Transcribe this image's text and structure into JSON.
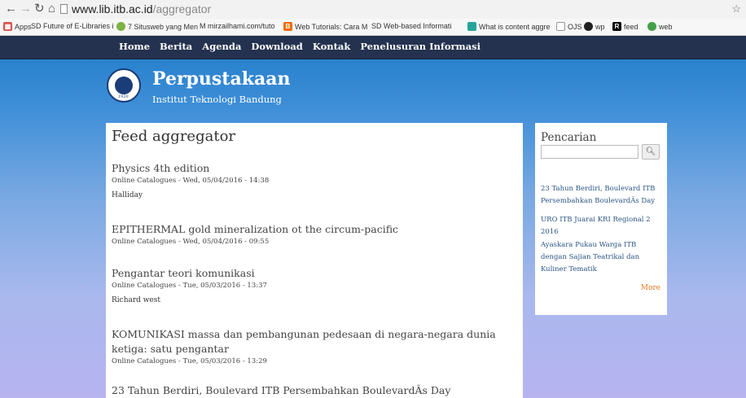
{
  "browser": {
    "url_host": "www.lib.itb.ac.id",
    "url_path": "/aggregator"
  },
  "bookmarks": [
    {
      "label": "Apps",
      "color": "#d9534f"
    },
    {
      "label": "SD Future of E-Libraries i",
      "color": "#6b8e23"
    },
    {
      "label": "7 Situsweb yang Men",
      "color": "#7cb342"
    },
    {
      "label": "M mirzailhami.com/tuto",
      "color": "#c62828"
    },
    {
      "label": "Web Tutorials: Cara M",
      "color": "#ef6c00"
    },
    {
      "label": "SD Web-based Informati",
      "color": "#6b8e23"
    },
    {
      "label": "What is content aggre",
      "color": "#26a69a"
    },
    {
      "label": "OJS",
      "color": "#9e9e9e"
    },
    {
      "label": "wp",
      "color": "#212121"
    },
    {
      "label": "feed",
      "color": "#000000"
    },
    {
      "label": "web",
      "color": "#43a047"
    }
  ],
  "site": {
    "nav": [
      "Home",
      "Berita",
      "Agenda",
      "Download",
      "Kontak",
      "Penelusuran Informasi"
    ],
    "title": "Perpustakaan",
    "subtitle": "Institut Teknologi Bandung",
    "logo_year": "1920"
  },
  "main": {
    "title": "Feed aggregator",
    "items": [
      {
        "title": "Physics 4th edition",
        "meta": "Online Catalogues - Wed, 05/04/2016 - 14:38",
        "desc": "Halliday"
      },
      {
        "title": "EPITHERMAL gold mineralization ot the circum-pacific",
        "meta": "Online Catalogues - Wed, 05/04/2016 - 09:55",
        "desc": ""
      },
      {
        "title": "Pengantar teori komunikasi",
        "meta": "Online Catalogues - Tue, 05/03/2016 - 13:37",
        "desc": "Richard west"
      },
      {
        "title": "KOMUNIKASI massa dan pembangunan pedesaan di negara-negara dunia ketiga: satu pengantar",
        "meta": "Online Catalogues - Tue, 05/03/2016 - 13:29",
        "desc": ""
      },
      {
        "title": "23 Tahun Berdiri, Boulevard ITB Persembahkan BoulevardÂs Day",
        "meta": "",
        "desc": ""
      }
    ]
  },
  "sidebar": {
    "title": "Pencarian",
    "search_placeholder": "",
    "search_button_icon": "search-icon",
    "news": [
      "23 Tahun Berdiri, Boulevard ITB Persembahkan BoulevardÂs Day",
      "URO ITB Juarai KRI Regional 2 2016",
      "Ayaskara Pukau Warga ITB dengan Sajian Teatrikal dan Kuliner Tematik"
    ],
    "more_label": "More"
  }
}
